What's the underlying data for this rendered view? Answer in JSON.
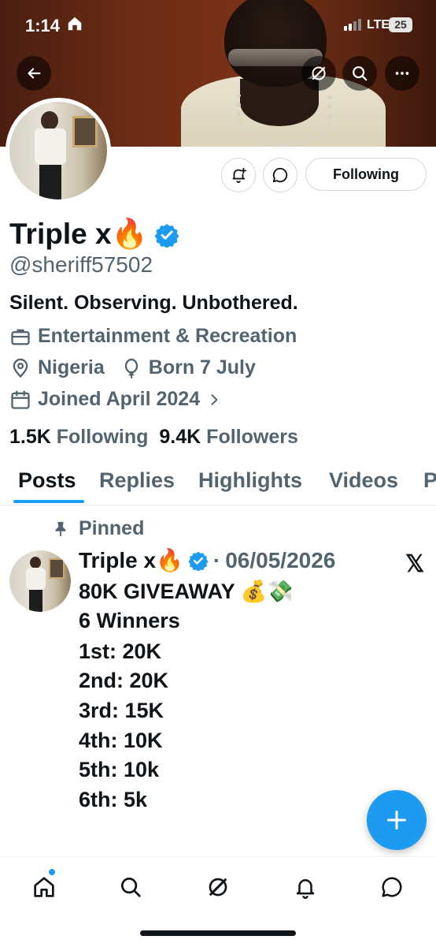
{
  "status_bar": {
    "time": "1:14",
    "network": "LTE",
    "battery": "25"
  },
  "banner": {
    "back_icon": "arrow-left-icon",
    "grok_icon": "slash-circle-icon",
    "search_icon": "search-icon",
    "more_icon": "more-horizontal-icon"
  },
  "profile": {
    "name": "Triple x🔥",
    "handle": "@sheriff57502",
    "bio": "Silent. Observing. Unbothered.",
    "category": "Entertainment & Recreation",
    "location": "Nigeria",
    "birthday": "Born 7 July",
    "joined": "Joined April 2024",
    "following_count": "1.5K",
    "following_label": "Following",
    "followers_count": "9.4K",
    "followers_label": "Followers",
    "follow_button_label": "Following",
    "verified_color": "#1d9bf0"
  },
  "tabs": [
    "Posts",
    "Replies",
    "Highlights",
    "Videos",
    "P"
  ],
  "active_tab": "Posts",
  "post": {
    "pinned_label": "Pinned",
    "author": "Triple x🔥",
    "separator": "·",
    "date": "06/05/2026",
    "lines": [
      "80K GIVEAWAY 💰💸",
      "6 Winners",
      "1st:  20K",
      "2nd: 20K",
      "3rd: 15K",
      "4th: 10K",
      "5th: 10k",
      "6th: 5k"
    ],
    "x_logo": "𝕏"
  },
  "accent_color": "#1d9bf0"
}
